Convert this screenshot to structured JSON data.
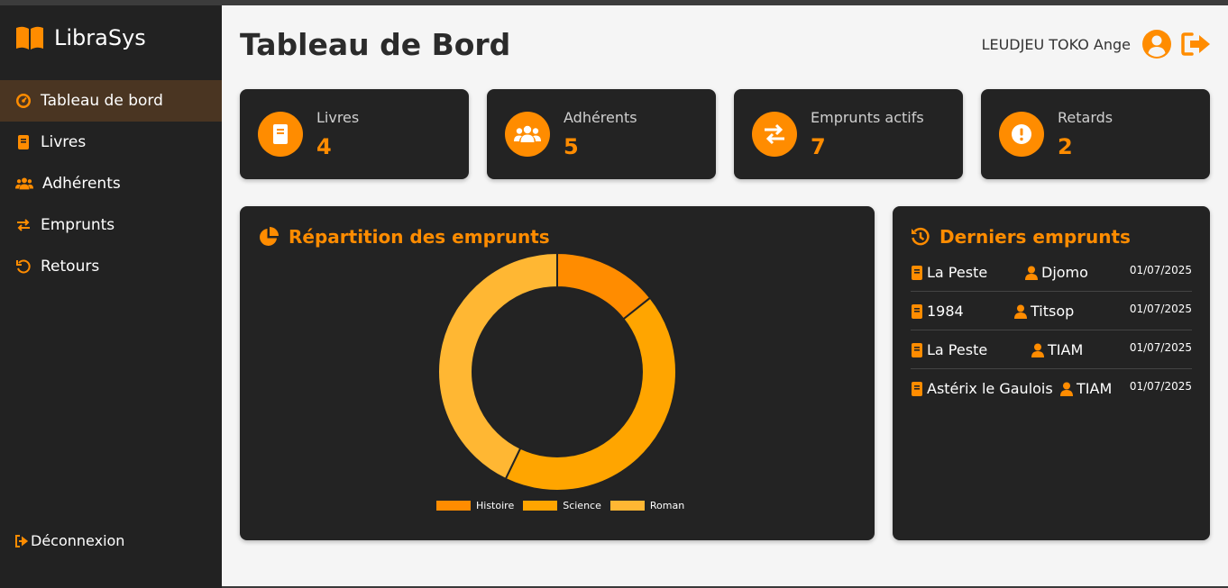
{
  "app": {
    "name": "LibraSys"
  },
  "sidebar": {
    "items": [
      {
        "label": "Tableau de bord",
        "icon": "dashboard-icon",
        "active": true
      },
      {
        "label": "Livres",
        "icon": "book-icon",
        "active": false
      },
      {
        "label": "Adhérents",
        "icon": "users-icon",
        "active": false
      },
      {
        "label": "Emprunts",
        "icon": "exchange-icon",
        "active": false
      },
      {
        "label": "Retours",
        "icon": "undo-icon",
        "active": false
      }
    ],
    "logout_label": "Déconnexion"
  },
  "header": {
    "title": "Tableau de Bord",
    "user_name": "LEUDJEU TOKO Ange"
  },
  "stats": [
    {
      "label": "Livres",
      "value": "4",
      "icon": "book-icon"
    },
    {
      "label": "Adhérents",
      "value": "5",
      "icon": "users-icon"
    },
    {
      "label": "Emprunts actifs",
      "value": "7",
      "icon": "exchange-icon"
    },
    {
      "label": "Retards",
      "value": "2",
      "icon": "alert-icon"
    }
  ],
  "chart_panel": {
    "title": "Répartition des emprunts"
  },
  "chart_data": {
    "type": "pie",
    "categories": [
      "Histoire",
      "Science",
      "Roman"
    ],
    "values": [
      1,
      3,
      3
    ],
    "colors": [
      "#ff8c00",
      "#ffa500",
      "#ffb733"
    ]
  },
  "loans_panel": {
    "title": "Derniers emprunts",
    "rows": [
      {
        "book": "La Peste",
        "user": "Djomo",
        "date": "01/07/2025"
      },
      {
        "book": "1984",
        "user": "Titsop",
        "date": "01/07/2025"
      },
      {
        "book": "La Peste",
        "user": "TIAM",
        "date": "01/07/2025"
      },
      {
        "book": "Astérix le Gaulois",
        "user": "TIAM",
        "date": "01/07/2025"
      }
    ]
  },
  "colors": {
    "accent": "#ff8c00",
    "sidebar_bg": "#222222",
    "card_bg": "#232323",
    "main_bg": "#f5f5f5"
  }
}
